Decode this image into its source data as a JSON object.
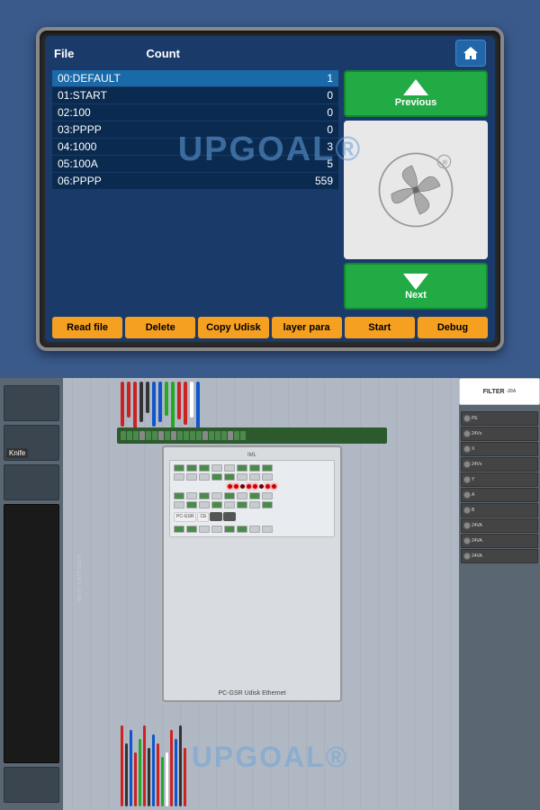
{
  "screen": {
    "header": {
      "col1": "File",
      "col2": "Count",
      "home_icon": "🏠"
    },
    "files": [
      {
        "id": "00:DEFAULT",
        "count": "1",
        "selected": true
      },
      {
        "id": "01:START",
        "count": "0",
        "selected": false
      },
      {
        "id": "02:100",
        "count": "0",
        "selected": false
      },
      {
        "id": "03:PPPP",
        "count": "0",
        "selected": false
      },
      {
        "id": "04:1000",
        "count": "3",
        "selected": false
      },
      {
        "id": "05:100A",
        "count": "5",
        "selected": false
      },
      {
        "id": "06:PPPP",
        "count": "559",
        "selected": false
      }
    ],
    "nav": {
      "prev_label": "Previous",
      "next_label": "Next"
    },
    "footer_buttons": [
      "Read file",
      "Delete",
      "Copy Udisk",
      "layer para",
      "Start",
      "Debug"
    ]
  },
  "watermark": "UPGOAL®",
  "watermark2": "UPGOAL®",
  "hardware": {
    "filter_label": "FILTER",
    "side_label": "anti-collision",
    "knife_label": "Knife",
    "pcb_bottom": "PC-GSR  Udisk  Ethernet"
  },
  "terminals": [
    "PE",
    "24Vx",
    "X",
    "24Vx",
    "Y",
    "A",
    "B",
    "24VA",
    "24VA",
    "24VA"
  ]
}
